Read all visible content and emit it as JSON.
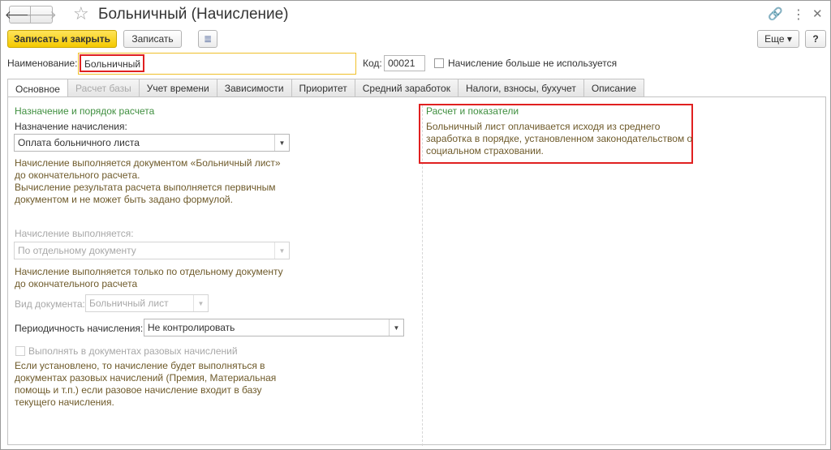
{
  "window": {
    "title": "Больничный (Начисление)",
    "nav_back": "🡐",
    "nav_forward": "🡒",
    "star": "☆",
    "link_icon": "🔗",
    "menu_icon": "⋮",
    "close_icon": "✕"
  },
  "toolbar": {
    "save_close_label": "Записать и закрыть",
    "save_label": "Записать",
    "doc_icon": "≣",
    "more_label": "Еще ▾",
    "help_label": "?"
  },
  "header": {
    "name_label": "Наименование:",
    "name_value": "Больничный",
    "code_label": "Код:",
    "code_value": "00021",
    "unused_label": "Начисление больше не используется"
  },
  "tabs": [
    {
      "label": "Основное",
      "state": "active"
    },
    {
      "label": "Расчет базы",
      "state": "disabled"
    },
    {
      "label": "Учет времени",
      "state": "normal"
    },
    {
      "label": "Зависимости",
      "state": "normal"
    },
    {
      "label": "Приоритет",
      "state": "normal"
    },
    {
      "label": "Средний заработок",
      "state": "normal"
    },
    {
      "label": "Налоги, взносы, бухучет",
      "state": "normal"
    },
    {
      "label": "Описание",
      "state": "normal"
    }
  ],
  "main": {
    "section_title": "Назначение и порядок расчета",
    "purpose_label": "Назначение начисления:",
    "purpose_value": "Оплата больничного листа",
    "purpose_note": [
      "Начисление выполняется документом «Больничный лист»",
      "до окончательного расчета.",
      "Вычисление результата расчета выполняется первичным",
      "документом и не может быть задано формулой."
    ],
    "performed_label": "Начисление выполняется:",
    "performed_value": "По отдельному документу",
    "performed_note": [
      "Начисление выполняется только по отдельному документу",
      "до окончательного расчета"
    ],
    "doctype_label": "Вид документа:",
    "doctype_value": "Больничный лист",
    "period_label": "Периодичность начисления:",
    "period_value": "Не контролировать",
    "onetime_label": "Выполнять в документах разовых начислений",
    "onetime_note": [
      "Если установлено, то начисление будет выполняться в",
      "документах разовых начислений (Премия, Материальная",
      "помощь и т.п.) если разовое начисление входит в базу",
      "текущего начисления."
    ]
  },
  "right": {
    "section_title": "Расчет и показатели",
    "note": [
      "Больничный лист оплачивается исходя из среднего",
      "заработка в порядке, установленном законодательством о",
      "социальном страховании."
    ]
  },
  "colors": {
    "accent_yellow": "#f4c900",
    "section_green": "#3f8f3f",
    "note_brown": "#6e5a2a",
    "highlight_red": "#e02020"
  }
}
